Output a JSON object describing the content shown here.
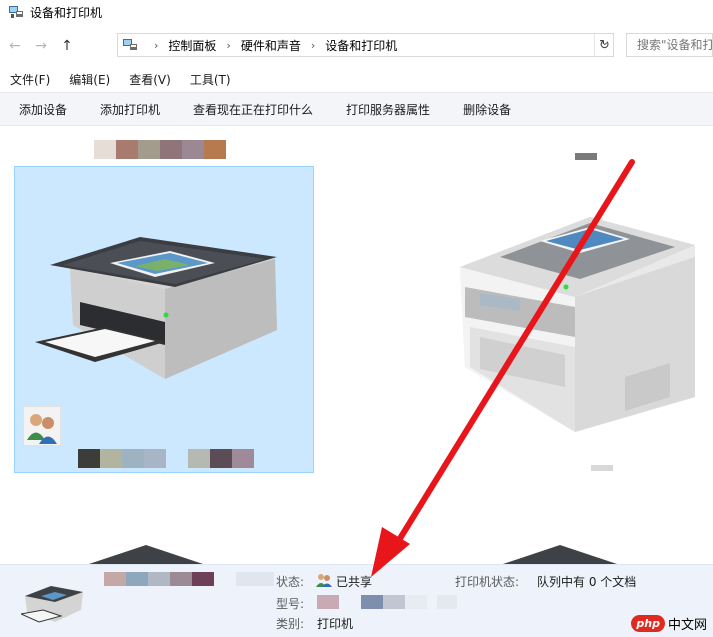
{
  "window": {
    "title": "设备和打印机",
    "icon": "devices-printers-icon"
  },
  "navigation": {
    "back_icon": "arrow-left-icon",
    "forward_icon": "arrow-right-icon",
    "up_icon": "arrow-up-icon",
    "breadcrumb": [
      "控制面板",
      "硬件和声音",
      "设备和打印机"
    ],
    "search_placeholder": "搜索\"设备和打印机\""
  },
  "menu": [
    "文件(F)",
    "编辑(E)",
    "查看(V)",
    "工具(T)"
  ],
  "commands": [
    "添加设备",
    "添加打印机",
    "查看现在正在打印什么",
    "打印服务器属性",
    "删除设备"
  ],
  "devices": [
    {
      "type": "printer",
      "selected": true,
      "shared": true
    },
    {
      "type": "printer",
      "selected": false,
      "shared": false
    }
  ],
  "details": {
    "status_label": "状态:",
    "status_value": "已共享",
    "model_label": "型号:",
    "category_label": "类别:",
    "category_value": "打印机",
    "printer_status_label": "打印机状态:",
    "printer_status_value": "队列中有 0 个文档"
  },
  "watermark": {
    "badge": "php",
    "text": "中文网"
  },
  "colors": {
    "selection": "#cce8ff",
    "command_bar": "#f3f5f9",
    "details_pane": "#eef3fb",
    "annotation_arrow": "#e8151b"
  }
}
